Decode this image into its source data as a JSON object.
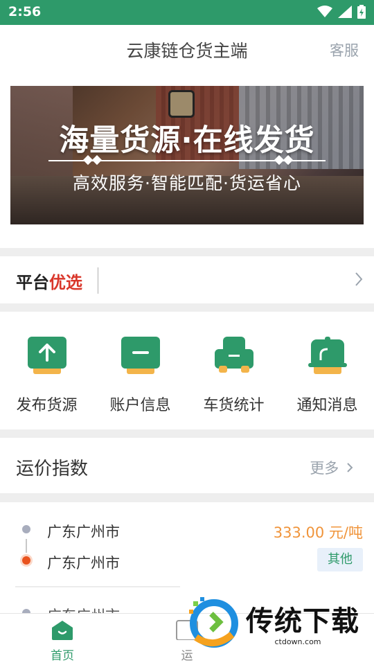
{
  "status_bar": {
    "time": "2:56"
  },
  "header": {
    "title": "云康链仓货主端",
    "service_label": "客服"
  },
  "banner": {
    "headline": "海量货源·在线发货",
    "subline": "高效服务·智能匹配·货运省心"
  },
  "preferred": {
    "label_black": "平台",
    "label_red": "优选"
  },
  "menu": {
    "items": [
      {
        "label": "发布货源",
        "icon": "upload-icon"
      },
      {
        "label": "账户信息",
        "icon": "account-icon"
      },
      {
        "label": "车货统计",
        "icon": "truck-stats-icon"
      },
      {
        "label": "通知消息",
        "icon": "notification-icon"
      }
    ]
  },
  "freight_index": {
    "title": "运价指数",
    "more_label": "更多",
    "routes": [
      {
        "from": "广东广州市",
        "to": "广东广州市",
        "price": "333.00 元/吨",
        "tag": "其他"
      }
    ],
    "next_route_from": "广东广州市"
  },
  "tabbar": {
    "tabs": [
      {
        "label": "首页",
        "active": true,
        "icon": "home-icon"
      },
      {
        "label": "运",
        "active": false,
        "icon": "waybill-icon"
      }
    ]
  },
  "watermark": {
    "name": "传统下载",
    "url": "ctdown.com"
  },
  "colors": {
    "brand": "#2e9a6a",
    "accent_orange": "#f3b44a",
    "price": "#f0943a",
    "red": "#d9362a"
  }
}
